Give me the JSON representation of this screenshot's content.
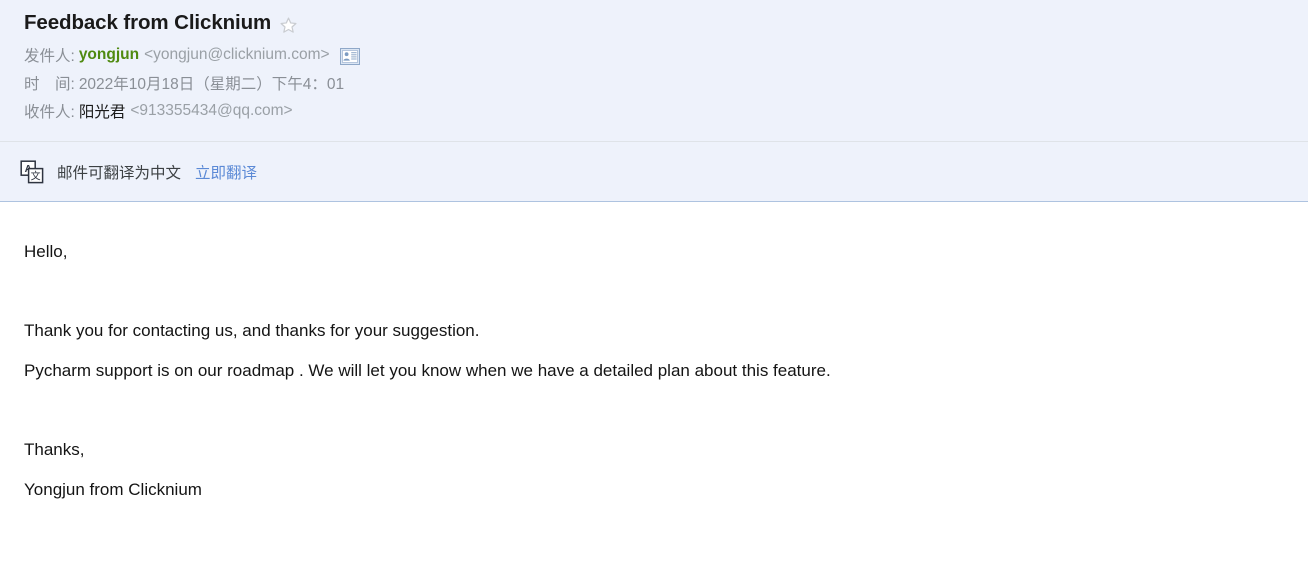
{
  "mail": {
    "subject": "Feedback from Clicknium",
    "star_icon": "star-outline-icon",
    "from": {
      "label": "发件人:",
      "name": "yongjun",
      "address": "<yongjun@clicknium.com>",
      "contact_icon": "contact-card-icon"
    },
    "date": {
      "label": "时　间:",
      "value": "2022年10月18日（星期二）下午4：01"
    },
    "to": {
      "label": "收件人:",
      "name": "阳光君",
      "address": "<913355434@qq.com>"
    }
  },
  "translate_bar": {
    "icon": "translate-icon",
    "notice": "邮件可翻译为中文",
    "action_label": "立即翻译"
  },
  "body": {
    "lines": [
      "Hello,",
      "",
      "Thank you for contacting us, and thanks for your suggestion.",
      "Pycharm support is on our roadmap . We will let you know when we have a detailed plan about this feature.",
      "",
      "Thanks,",
      "Yongjun from Clicknium"
    ]
  },
  "colors": {
    "header_bg": "#eef2fb",
    "sender_green": "#4f8a10",
    "link_blue": "#5c8ad6",
    "meta_grey": "#8a8f96",
    "body_text": "#141414",
    "bar_border": "#aec3e0"
  }
}
